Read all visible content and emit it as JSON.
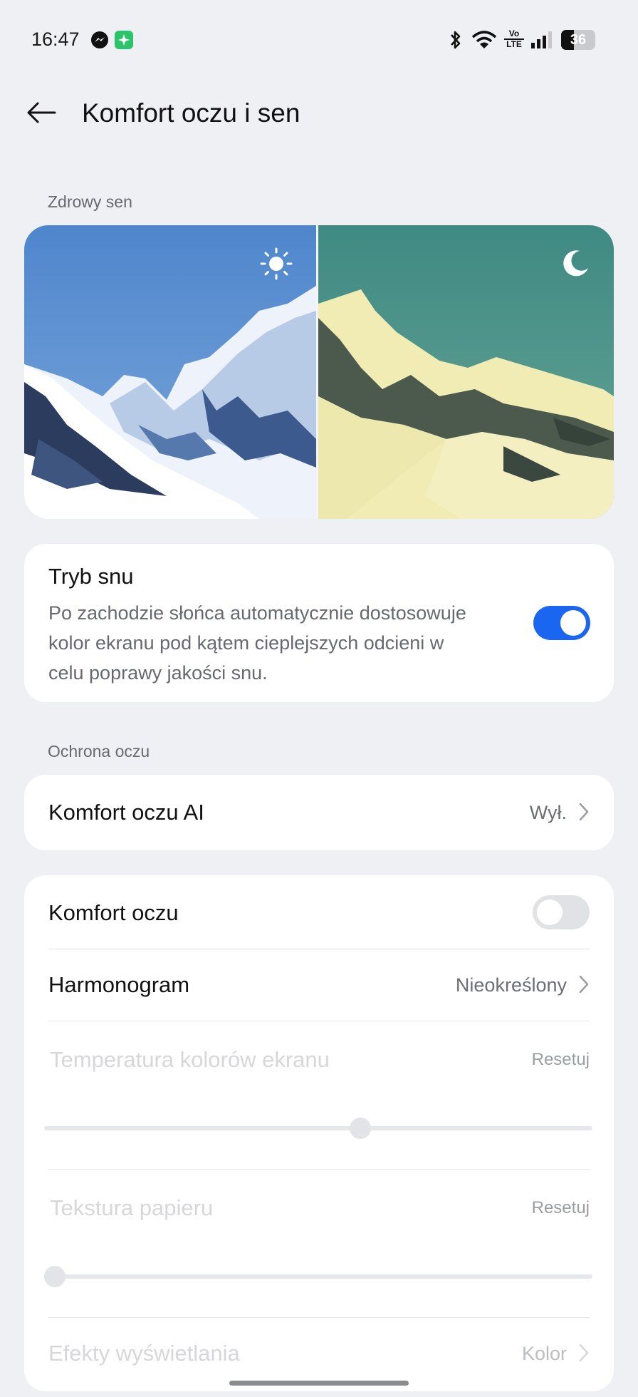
{
  "status_bar": {
    "time": "16:47",
    "battery": "36",
    "icons": [
      "messenger-icon",
      "app-notification-icon",
      "bluetooth-icon",
      "wifi-icon",
      "volte-icon",
      "signal-icon",
      "battery-icon"
    ],
    "volte_top": "Vo",
    "volte_bottom": "LTE"
  },
  "header": {
    "title": "Komfort oczu i sen",
    "back_icon": "arrow-left-icon"
  },
  "healthy_sleep": {
    "section_label": "Zdrowy sen",
    "hero_icons": [
      "sun-icon",
      "moon-icon"
    ]
  },
  "sleep_mode": {
    "title": "Tryb snu",
    "description_lines": [
      "Po zachodzie słońca automatycznie dostosowuje",
      "kolor ekranu pod kątem cieplejszych odcieni w",
      "celu poprawy jakości snu."
    ],
    "enabled": true
  },
  "eye_protection": {
    "section_label": "Ochrona oczu",
    "ai": {
      "title": "Komfort oczu AI",
      "value": "Wył."
    },
    "eye_comfort": {
      "title": "Komfort oczu",
      "enabled": false
    },
    "schedule": {
      "title": "Harmonogram",
      "value": "Nieokreślony"
    },
    "color_temperature": {
      "title": "Temperatura kolorów ekranu",
      "reset": "Resetuj",
      "level": 0.58
    },
    "paper_texture": {
      "title": "Tekstura papieru",
      "reset": "Resetuj",
      "level": 0.0
    },
    "display_effects": {
      "title": "Efekty wyświetlania",
      "value": "Kolor"
    }
  },
  "colors": {
    "accent": "#1a66f0",
    "background": "#eef0f3",
    "card": "#ffffff"
  }
}
